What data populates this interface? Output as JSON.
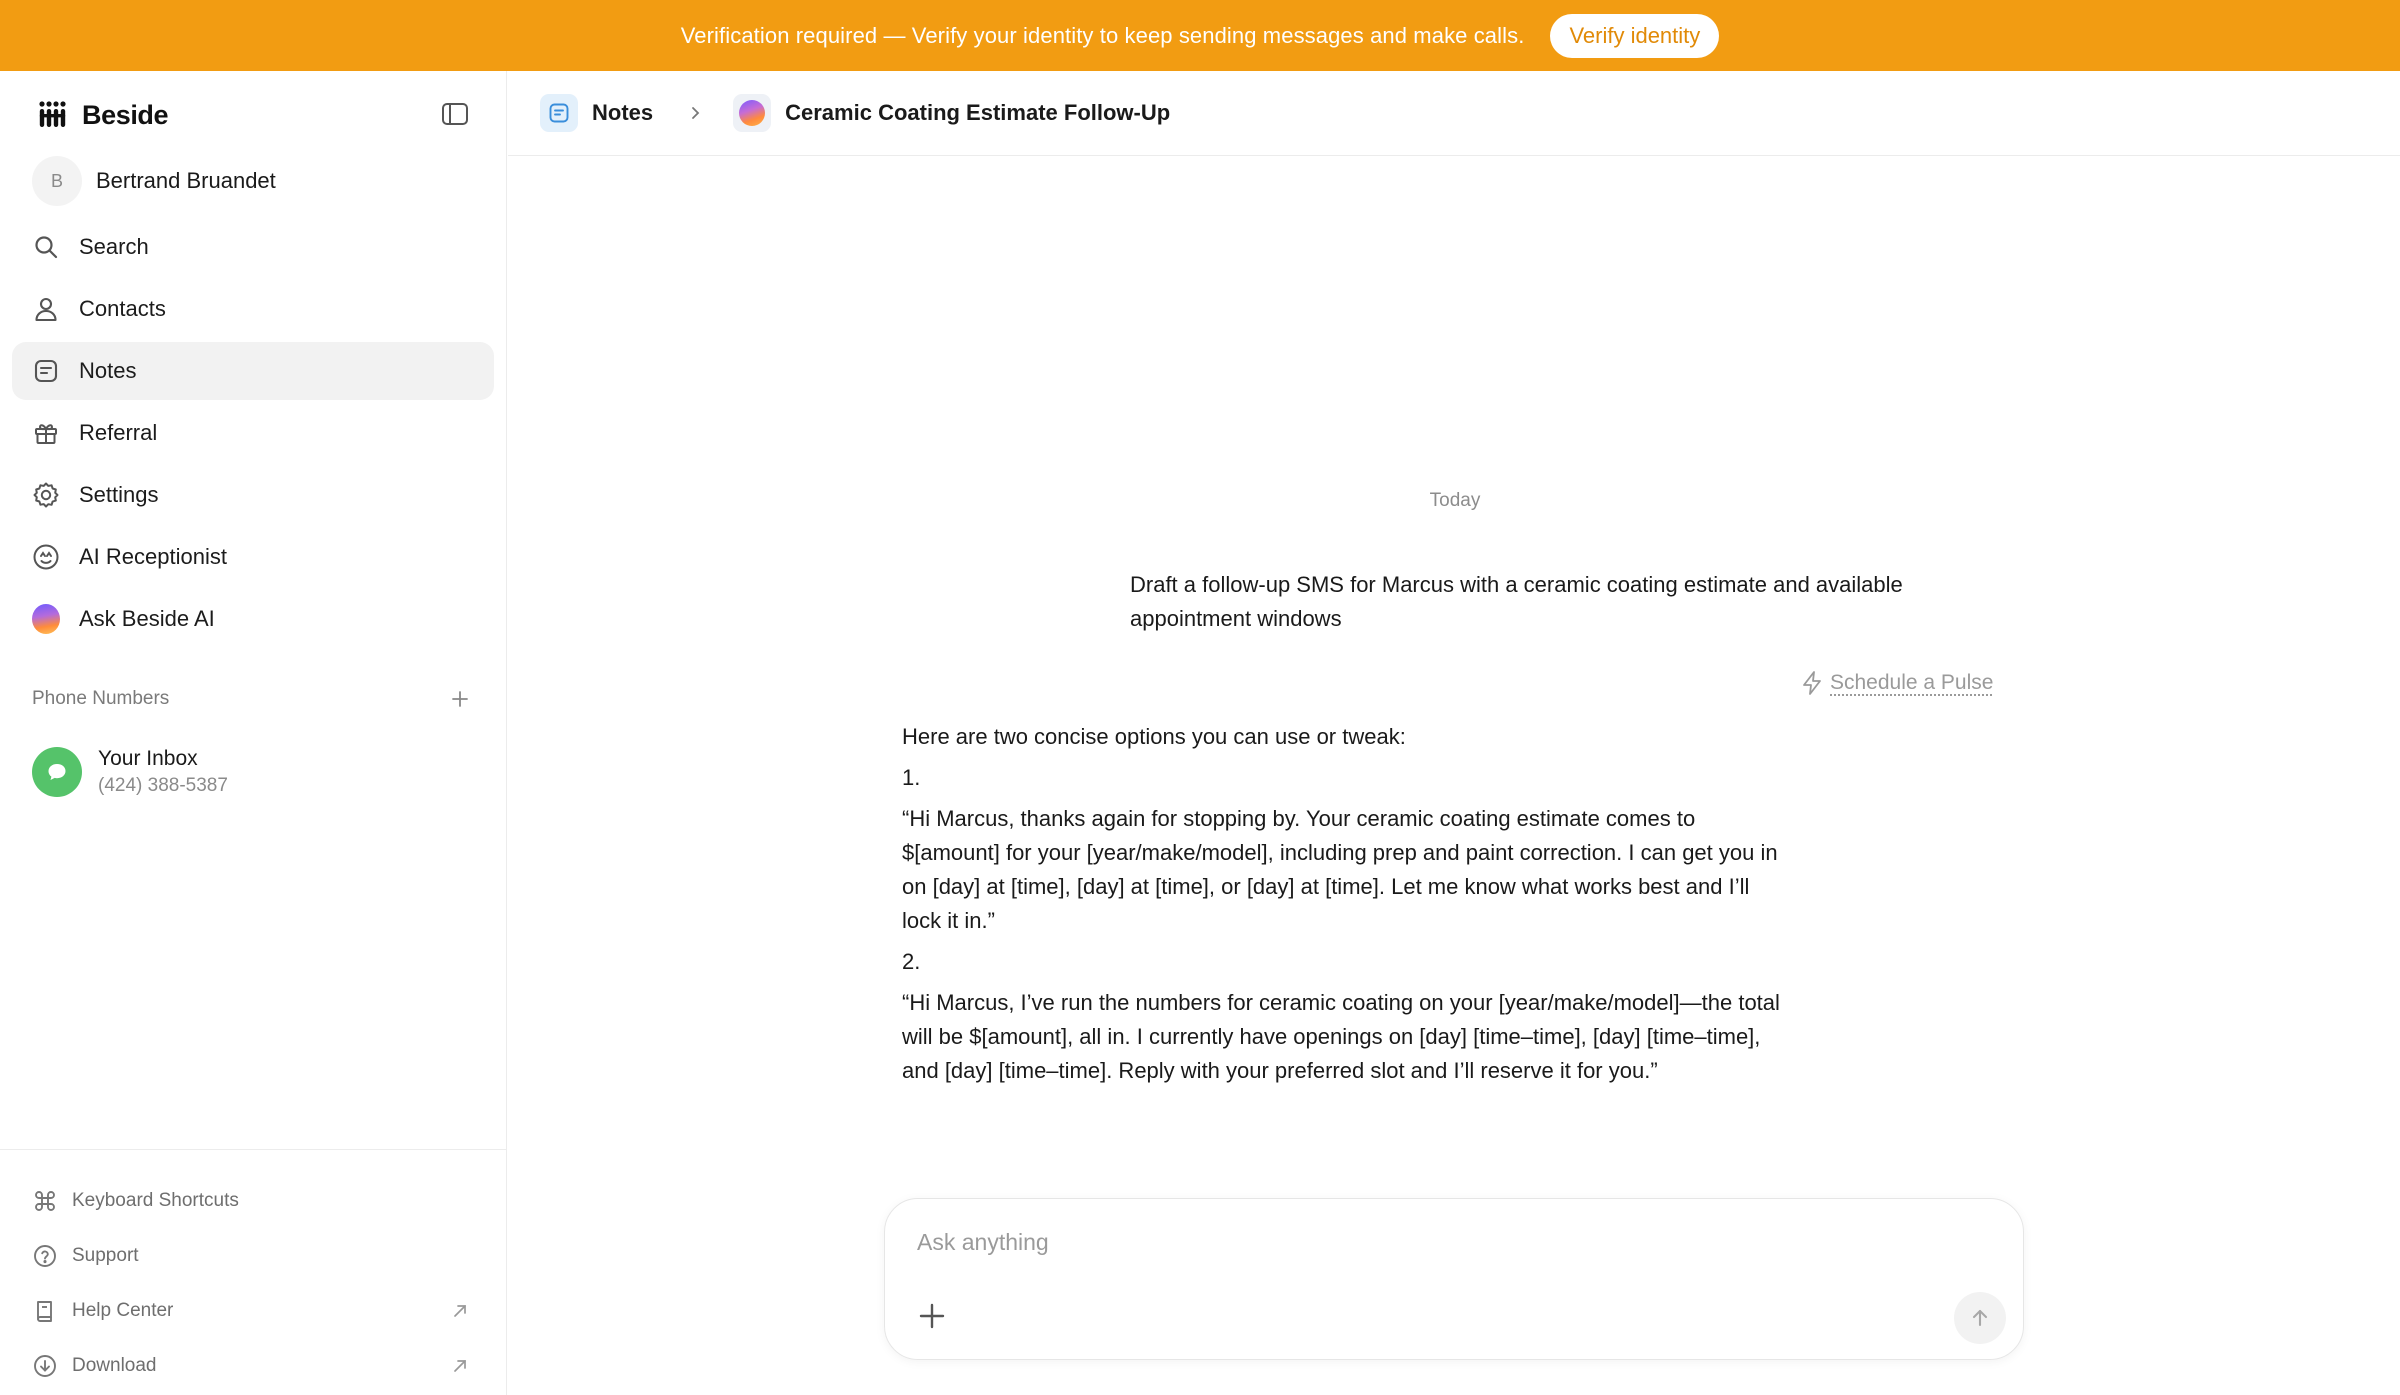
{
  "banner": {
    "text": "Verification required — Verify your identity to keep sending messages and make calls.",
    "button": "Verify identity",
    "color": "#F29C12"
  },
  "sidebar": {
    "brand": "Beside",
    "user": {
      "initial": "B",
      "name": "Bertrand Bruandet"
    },
    "items": [
      {
        "label": "Search",
        "icon": "search-icon"
      },
      {
        "label": "Contacts",
        "icon": "person-icon"
      },
      {
        "label": "Notes",
        "icon": "note-icon",
        "active": true
      },
      {
        "label": "Referral",
        "icon": "gift-icon"
      },
      {
        "label": "Settings",
        "icon": "gear-icon"
      },
      {
        "label": "AI Receptionist",
        "icon": "receptionist-icon"
      },
      {
        "label": "Ask Beside AI",
        "icon": "orb-icon"
      }
    ],
    "phone_numbers": {
      "title": "Phone Numbers",
      "inbox": {
        "name": "Your Inbox",
        "number": "(424) 388-5387"
      }
    },
    "footer": [
      {
        "label": "Keyboard Shortcuts",
        "icon": "command-icon"
      },
      {
        "label": "Support",
        "icon": "help-circle-icon"
      },
      {
        "label": "Help Center",
        "icon": "book-icon",
        "external": true
      },
      {
        "label": "Download",
        "icon": "download-icon",
        "external": true
      }
    ]
  },
  "breadcrumb": {
    "section": "Notes",
    "title": "Ceramic Coating Estimate Follow-Up"
  },
  "conversation": {
    "day": "Today",
    "user_message": "Draft a follow-up SMS for Marcus with a ceramic coating estimate and available appointment windows",
    "pulse_label": "Schedule a Pulse",
    "reply": {
      "intro": "Here are two concise options you can use or tweak:",
      "option1_num": "1.",
      "option1": "“Hi Marcus, thanks again for stopping by. Your ceramic coating estimate comes to $[amount] for your [year/make/model], including prep and paint correction. I can get you in on [day] at [time], [day] at [time], or [day] at [time]. Let me know what works best and I’ll lock it in.”",
      "option2_num": "2.",
      "option2": "“Hi Marcus, I’ve run the numbers for ceramic coating on your [year/make/model]—the total will be $[amount], all in. I currently have openings on [day] [time–time], [day] [time–time], and [day] [time–time]. Reply with your preferred slot and I’ll reserve it for you.”"
    }
  },
  "composer": {
    "placeholder": "Ask anything"
  }
}
